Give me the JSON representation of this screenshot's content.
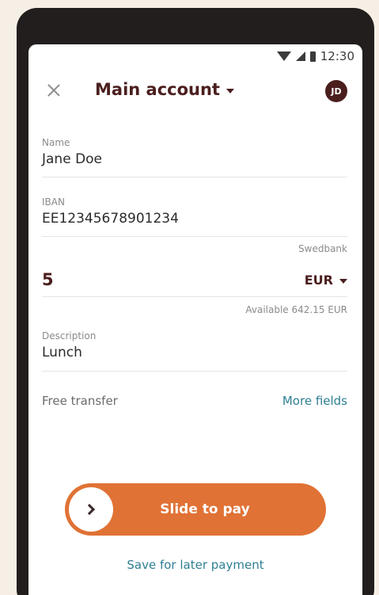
{
  "status": {
    "time": "12:30"
  },
  "header": {
    "title": "Main account",
    "avatar_initials": "JD"
  },
  "form": {
    "name": {
      "label": "Name",
      "value": "Jane Doe"
    },
    "iban": {
      "label": "IBAN",
      "value": "EE12345678901234"
    },
    "bank": "Swedbank",
    "amount": {
      "value": "5",
      "currency": "EUR",
      "available": "Available 642.15 EUR"
    },
    "description": {
      "label": "Description",
      "value": "Lunch"
    },
    "free_transfer": "Free transfer",
    "more_fields": "More fields"
  },
  "actions": {
    "slide_to_pay": "Slide to pay",
    "save_later": "Save for later payment"
  },
  "colors": {
    "brand": "#4b1e1e",
    "accent": "#e07235",
    "link": "#2f7f93"
  }
}
